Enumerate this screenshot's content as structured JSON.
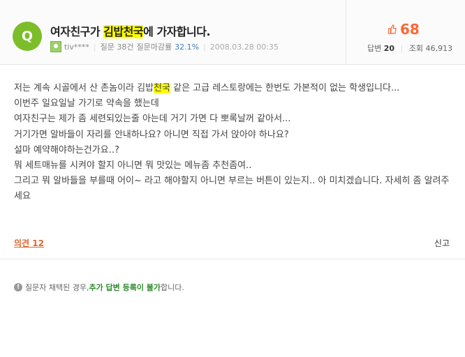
{
  "question": {
    "badge": "Q",
    "title_prefix": "여자친구가 ",
    "title_highlight": "김밥천국",
    "title_suffix": "에 가자합니다."
  },
  "author": {
    "name": "tiv****",
    "questions_label": "질문 38건",
    "close_rate_label": "질문마감률",
    "close_rate_value": "32.1%",
    "date": "2008.03.28 00:35"
  },
  "stats": {
    "score": "68",
    "answers_label": "답변",
    "answers_count": "20",
    "views_label": "조회",
    "views_count": "46,913"
  },
  "body": {
    "line1_pre": "저는 계속 시골에서 산 촌놈이라 김밥",
    "line1_highlight": "천국",
    "line1_post": " 같은 고급 레스토랑에는 한번도 가본적이 없는 학생입니다...",
    "lines": [
      "이번주 일요일날 가기로 약속을 했는데",
      "여자친구는 제가 좀 세련되있는줄 아는데 거기 가면 다 뽀록날꺼 같아서...",
      "거기가면 알바들이 자리를 안내하나요? 아니면 직접 가서 앉아야 하나요?",
      "설마 예약해야하는건가요..?",
      "뭐 세트매뉴를 시켜야 할지 아니면 뭐 맛있는 메뉴좀 추천좀여..",
      "그리고 뭐 알바들을 부를때 어이~ 라고 해야할지 아니면 부르는 버튼이 있는지.. 아 미치겠습니다. 자세히 좀 알려주세요"
    ]
  },
  "actions": {
    "opinions": "의견 12",
    "report": "신고"
  },
  "notice": {
    "icon": "!",
    "text_pre": "질문자 채택된 경우, ",
    "text_green": "추가 답변 등록이 불가",
    "text_post": "합니다."
  },
  "colors": {
    "badge": "#7cbd2a",
    "score": "#ff6633",
    "highlight": "#ffff00",
    "opinions": "#e0662d",
    "notice_green": "#2e8b2e"
  }
}
